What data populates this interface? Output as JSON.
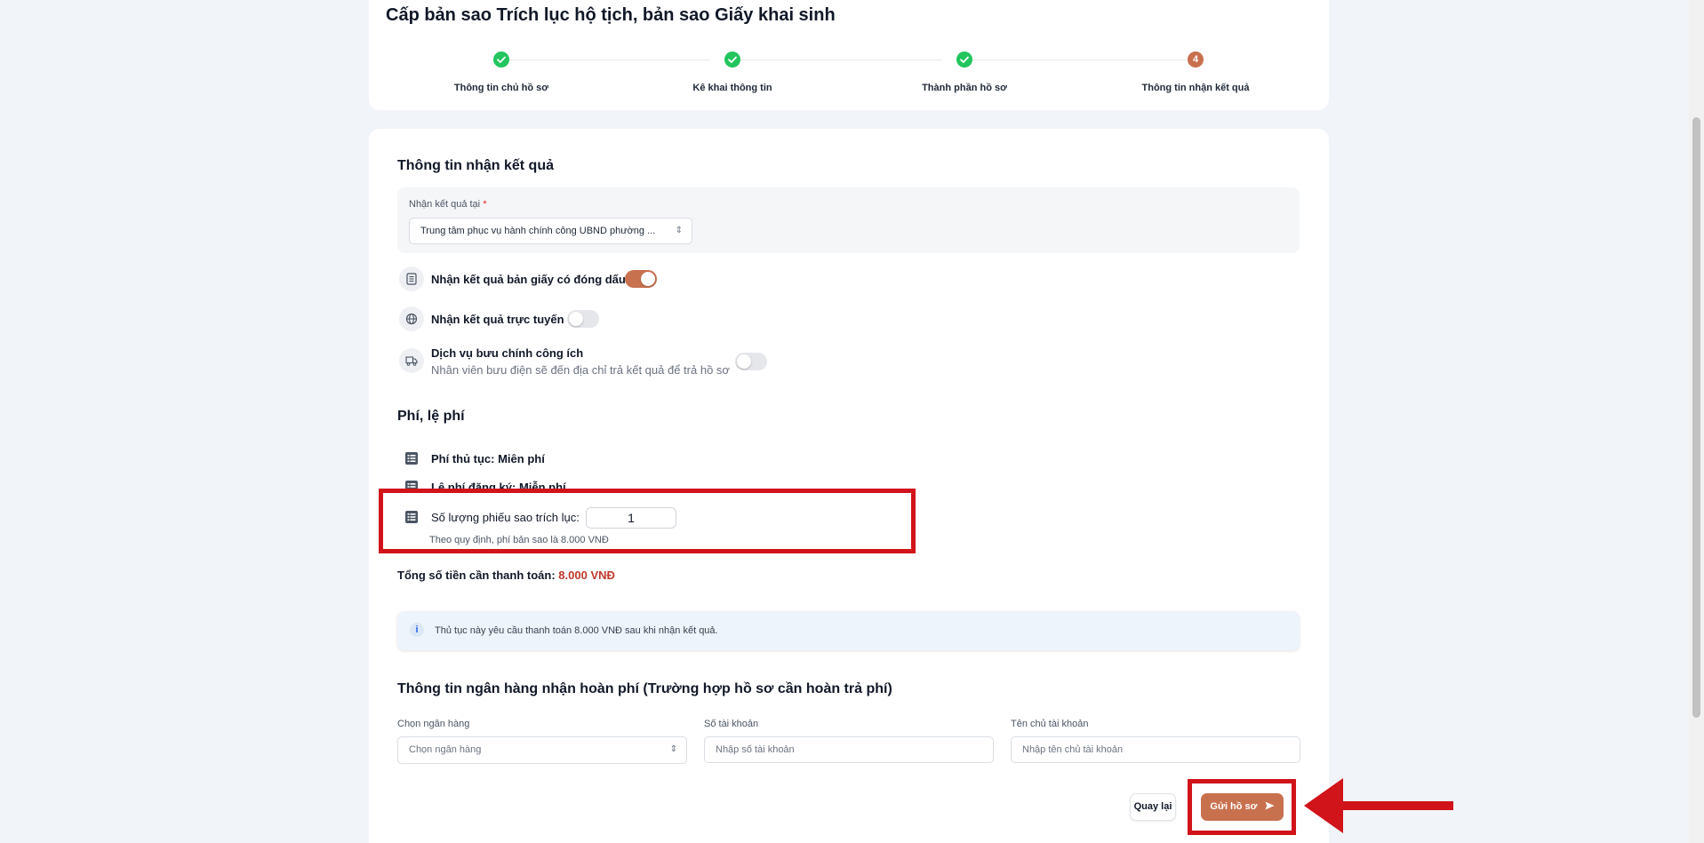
{
  "page": {
    "title": "Cấp bản sao Trích lục hộ tịch, bản sao Giấy khai sinh"
  },
  "stepper": {
    "steps": [
      {
        "label": "Thông tin chủ hồ sơ",
        "state": "done"
      },
      {
        "label": "Kê khai thông tin",
        "state": "done"
      },
      {
        "label": "Thành phần hồ sơ",
        "state": "done"
      },
      {
        "label": "Thông tin nhận kết quả",
        "state": "active",
        "number": "4"
      }
    ]
  },
  "receive": {
    "section_title": "Thông tin nhận kết quả",
    "location_label": "Nhận kết quả tại",
    "location_required": "*",
    "location_value": "Trung tâm phục vụ hành chính công UBND phường ...",
    "options": [
      {
        "label": "Nhận kết quả bản giấy có đóng dấu",
        "icon": "document-icon",
        "enabled": true
      },
      {
        "label": "Nhận kết quả trực tuyến",
        "icon": "globe-icon",
        "enabled": false
      },
      {
        "label": "Dịch vụ bưu chính công ích",
        "sublabel": "Nhân viên bưu điện sẽ đến địa chỉ trả kết quả để trả hồ sơ",
        "icon": "truck-icon",
        "enabled": false
      }
    ]
  },
  "fees": {
    "section_title": "Phí, lệ phí",
    "procedure_fee": "Phí thủ tục: Miên phí",
    "registration_fee": "Lệ phí đăng ký: Miễn phí",
    "quantity_label": "Số lượng phiếu sao trích lục:",
    "quantity_value": "1",
    "quantity_note": "Theo quy định, phí bản sao là 8.000 VNĐ",
    "total_label": "Tổng số tiền cần thanh toán:",
    "total_amount": "8.000 VNĐ",
    "info_text": "Thủ tục này yêu cầu thanh toán 8.000 VNĐ sau khi nhận kết quả.",
    "info_icon": "info-icon"
  },
  "bank": {
    "section_title": "Thông tin ngân hàng nhận hoàn phí (Trường hợp hồ sơ cần hoàn trả phí)",
    "bank_label": "Chọn ngân hàng",
    "bank_placeholder": "Chọn ngân hàng",
    "account_label": "Số tài khoản",
    "account_placeholder": "Nhập số tài khoản",
    "owner_label": "Tên chủ tài khoản",
    "owner_placeholder": "Nhập tên chủ tài khoản"
  },
  "actions": {
    "back_label": "Quay lại",
    "submit_label": "Gửi hồ sơ",
    "submit_icon": "send-icon"
  },
  "colors": {
    "accent": "#c8714f",
    "success": "#22c55e",
    "annotation_red": "#d0141a",
    "amount_red": "#c0392b"
  }
}
